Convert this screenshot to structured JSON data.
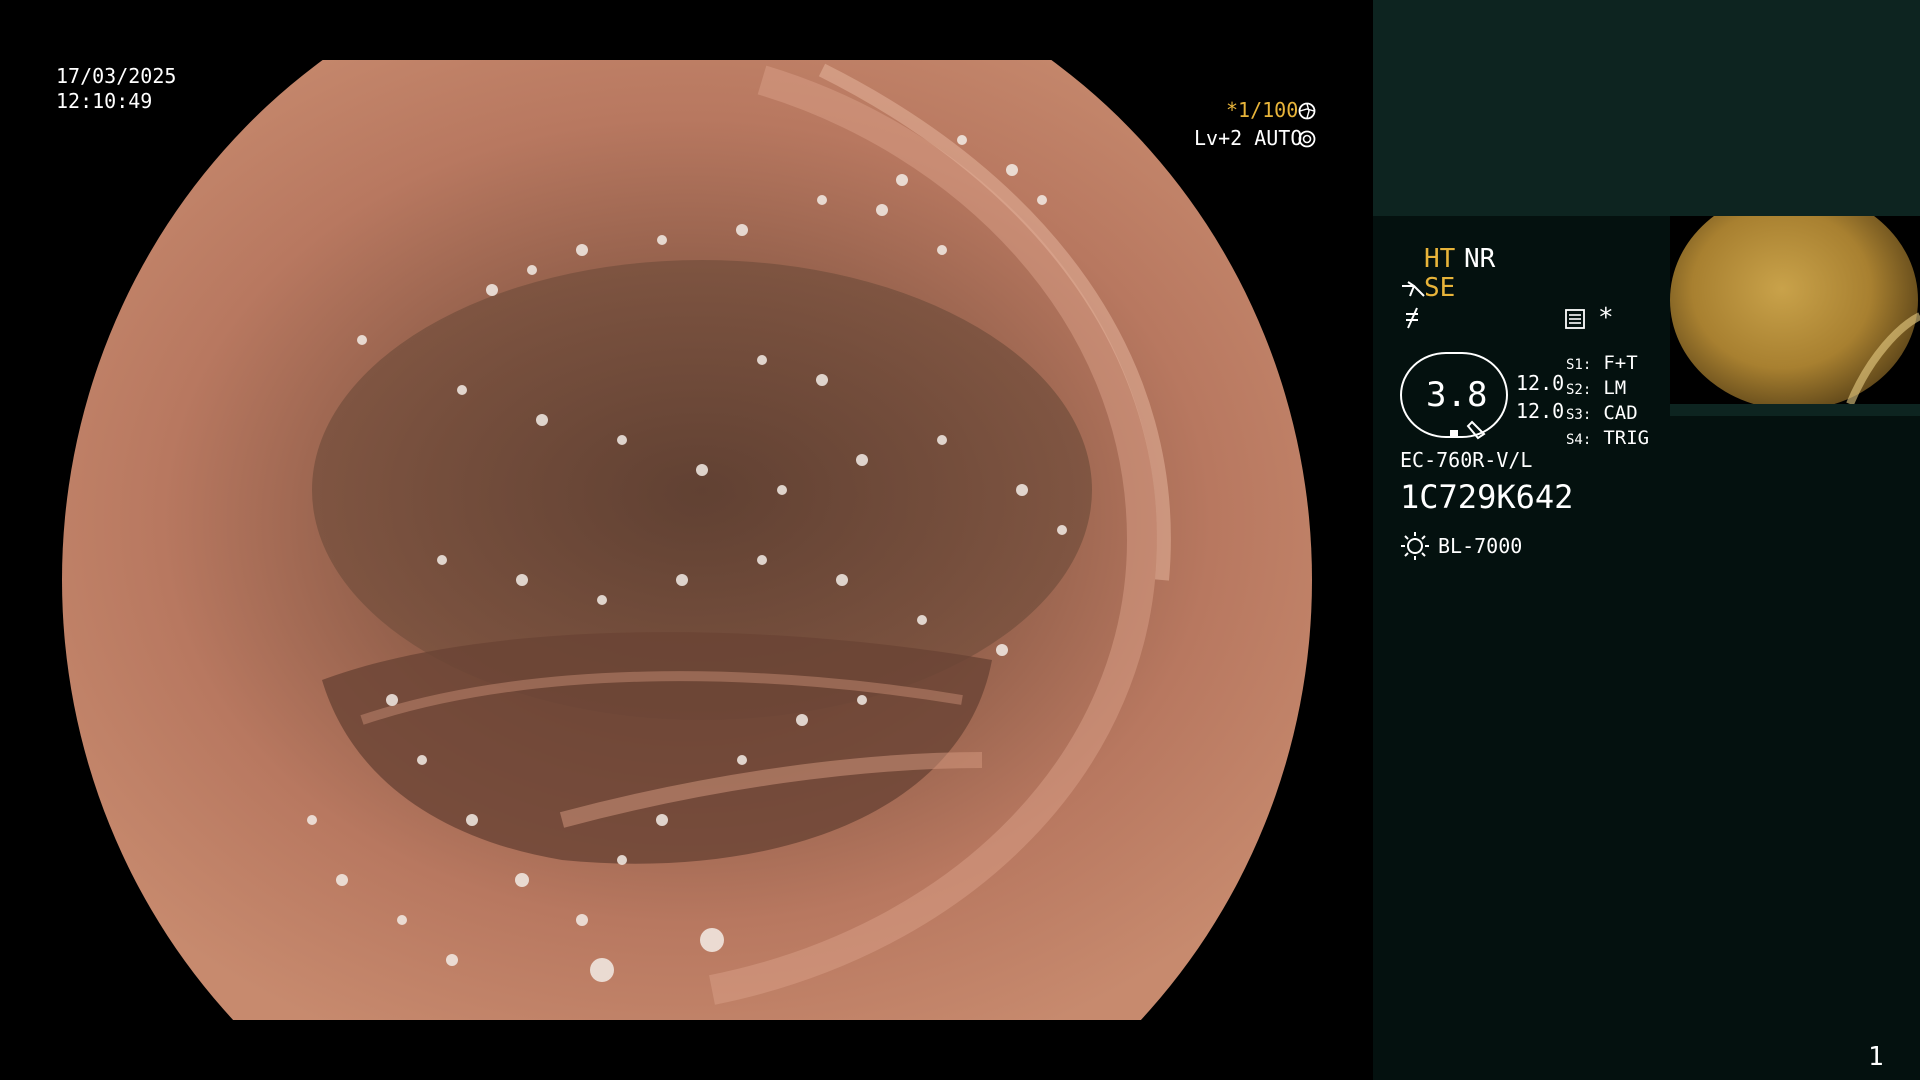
{
  "overlay": {
    "date": "17/03/2025",
    "time": "12:10:49",
    "shutter": "*1/100",
    "level_mode": "Lv+2 AUTO"
  },
  "panel": {
    "ht_label": "HT",
    "nr_label": "NR",
    "se_label": "SE",
    "gauge_value": "3.8",
    "readout_1": "12.0",
    "readout_2": "12.0",
    "asterisk": "*",
    "switches": [
      {
        "key": "S1",
        "value": "F+T"
      },
      {
        "key": "S2",
        "value": "LM"
      },
      {
        "key": "S3",
        "value": "CAD"
      },
      {
        "key": "S4",
        "value": "TRIG"
      }
    ],
    "scope_model": "EC-760R-V/L",
    "serial": "1C729K642",
    "light_source": "BL-7000",
    "page_number": "1"
  },
  "colors": {
    "accent": "#e8b43a",
    "panel_bg": "#04110f",
    "panel_band": "#0d2420",
    "tissue": "#b06c54"
  },
  "icons": [
    "shutter-icon",
    "auto-iris-icon",
    "scope-tip-icon",
    "no-signal-icon",
    "menu-icon",
    "light-icon"
  ]
}
